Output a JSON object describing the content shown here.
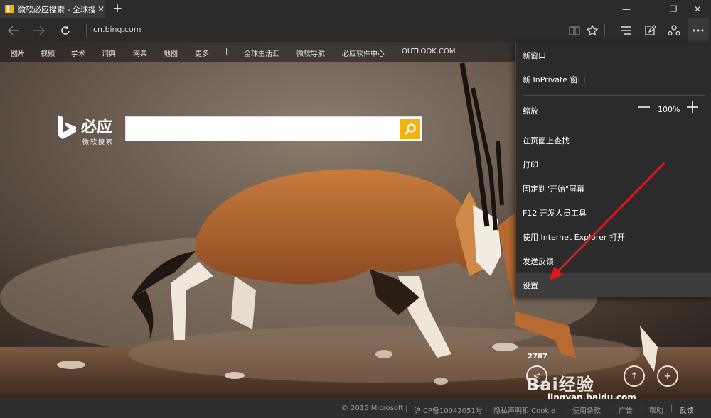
{
  "browser": {
    "tab_title": "微软必应搜索 - 全球搜索",
    "tab_close": "✕",
    "new_tab": "+",
    "window_buttons": [
      "—",
      "❐",
      "✕"
    ],
    "url": "cn.bing.com"
  },
  "top_links": [
    "图片",
    "视频",
    "学术",
    "词典",
    "网典",
    "地图",
    "更多",
    "|",
    "全球生活汇",
    "微软导航",
    "必应软件中心",
    "OUTLOOK.COM"
  ],
  "logo": {
    "brand": "必应",
    "tagline": "微软搜索"
  },
  "search": {
    "placeholder": ""
  },
  "menu": {
    "new_window": "新窗口",
    "new_inprivate": "新 InPrivate 窗口",
    "zoom_label": "缩放",
    "zoom_value": "100%",
    "find_on_page": "在页面上查找",
    "print": "打印",
    "pin_to_start": "固定到\"开始\"屏幕",
    "f12_tools": "F12 开发人员工具",
    "open_with_ie": "使用 Internet Explorer 打开",
    "send_feedback": "发送反馈",
    "settings": "设置"
  },
  "footer": [
    "© 2015 Microsoft",
    "|",
    "沪ICP备10042051号",
    "|",
    "隐私声明和 Cookie",
    "|",
    "使用条款",
    "|",
    "广告",
    "|",
    "帮助",
    "|",
    "反馈"
  ],
  "watermark": {
    "share_count": "2787",
    "brand": "Bai经验",
    "url": "jingyan.baidu.com"
  },
  "colors": {
    "accent": "#f5b20f",
    "menu_bg": "#2b2b2b",
    "arrow": "#e01818"
  }
}
